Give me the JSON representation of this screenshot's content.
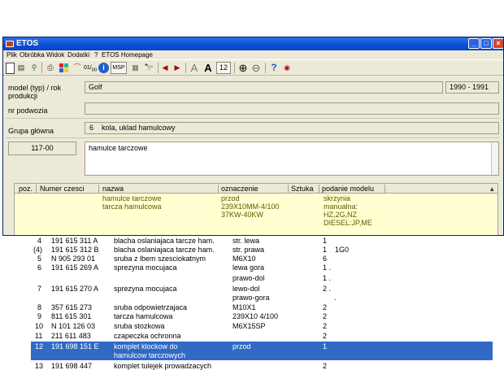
{
  "window": {
    "title": "ETOS"
  },
  "menu": [
    "Plik",
    "Obróbka",
    "Widok",
    "Dodatki",
    "?",
    "ETOS Homepage"
  ],
  "toolbar": {
    "font_size": "12",
    "msp_label": "MSP"
  },
  "fields": {
    "model_label": "model (typ) / rok produkcji",
    "model_value": "Golf",
    "years": "1990 - 1991",
    "chassis_label": "nr podwozia",
    "group_label": "Grupa główna",
    "group_num": "6",
    "group_value": "kola, uklad hamulcowy",
    "subgroup_code": "117-00",
    "subgroup_value": "hamulce tarczowe"
  },
  "table": {
    "headers": [
      "poz.",
      "Numer czesci",
      "nazwa",
      "oznaczenie",
      "Sztuka",
      "podanie modelu"
    ],
    "highlight": {
      "name1": "hamulce tarczowe",
      "name2": "tarcza hamulcowa",
      "oz1": "przod",
      "oz2": "239X10MM-4/100",
      "oz3": "37KW-40KW",
      "pm1": "skrzynia",
      "pm2": "manualna:",
      "pm3": "HZ,2G,NZ",
      "pm4": "DIESEL:JP,ME"
    },
    "rows": [
      {
        "poz": "4",
        "num": "191 615 311 A",
        "name": "blacha oslaniajaca tarcze ham.",
        "oz": "str. lewa",
        "szt": "1",
        "pm": ""
      },
      {
        "poz": "(4)",
        "num": "191 615 312 B",
        "name": "blacha oslaniajaca tarcze ham.",
        "oz": "str. prawa",
        "szt": "1",
        "pm": "1G0"
      },
      {
        "poz": "5",
        "num": "N  905 293 01",
        "name": "sruba  z lbem szesciokatnym",
        "oz": "M6X10",
        "szt": "6",
        "pm": ""
      },
      {
        "poz": "6",
        "num": "191 615 269 A",
        "name": "sprezyna mocujaca",
        "oz": "lewa gora",
        "szt": "1  .",
        "pm": ""
      },
      {
        "poz": "",
        "num": "",
        "name": "",
        "oz": "prawo-dol",
        "szt": "1  .",
        "pm": ""
      },
      {
        "poz": "7",
        "num": "191 615 270 A",
        "name": "sprezyna mocujaca",
        "oz": "lewo-dol",
        "szt": "2  .",
        "pm": ""
      },
      {
        "poz": "",
        "num": "",
        "name": "",
        "oz": "prawo-gora",
        "szt": ".",
        "pm": ""
      },
      {
        "poz": "8",
        "num": "357 615 273",
        "name": "sruba odpowietrzajaca",
        "oz": "M10X1",
        "szt": "2",
        "pm": ""
      },
      {
        "poz": "9",
        "num": "811 615 301",
        "name": "tarcza hamulcowa",
        "oz": "239X10  4/100",
        "szt": "2",
        "pm": ""
      },
      {
        "poz": "10",
        "num": "N  101 126 03",
        "name": "sruba stozkowa",
        "oz": "M6X15SP",
        "szt": "2",
        "pm": ""
      },
      {
        "poz": "11",
        "num": "211 611 483",
        "name": "czapeczka ochronna",
        "oz": "",
        "szt": "2",
        "pm": ""
      }
    ],
    "selected": {
      "poz": "12",
      "num": "191 698 151 E",
      "name1": "komplet klockow do",
      "name2": "hamulcow tarczowych",
      "oz": "przod",
      "szt": "1"
    },
    "last": {
      "poz": "13",
      "num": "191 698 447",
      "name": "komplet tulejek prowadzacych",
      "szt": "2"
    }
  }
}
